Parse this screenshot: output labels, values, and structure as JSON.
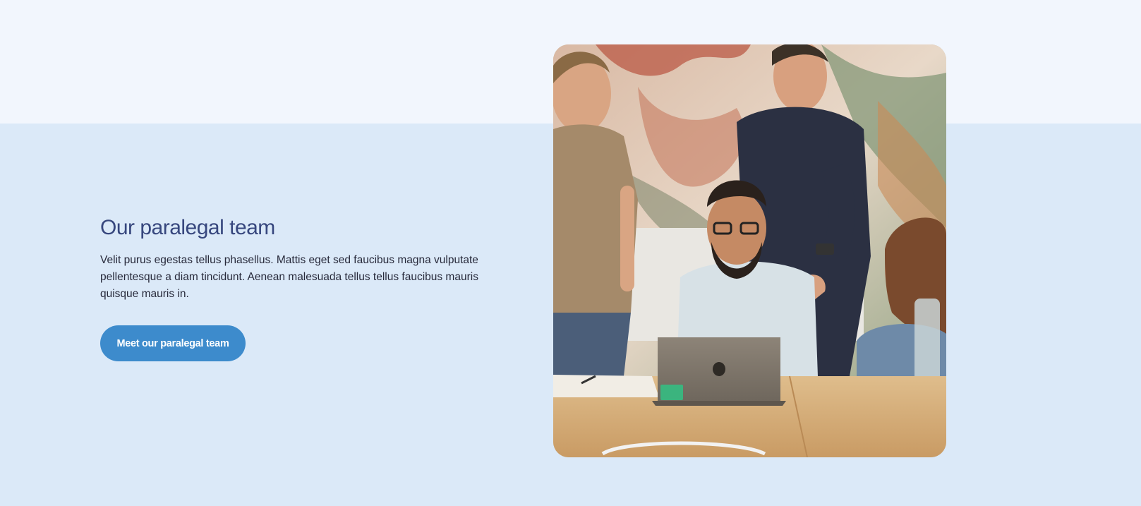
{
  "section": {
    "title": "Our paralegal team",
    "body": "Velit purus egestas tellus phasellus. Mattis eget sed faucibus magna vulputate pellentesque a diam tincidunt. Aenean malesuada tellus tellus faucibus mauris quisque mauris in.",
    "cta_label": "Meet our paralegal team"
  },
  "colors": {
    "page_background": "#dbe9f8",
    "top_band": "#f2f6fd",
    "title": "#37477e",
    "body_text": "#27293a",
    "button": "#3d8bcc",
    "button_text": "#ffffff"
  },
  "image": {
    "subject": "team-photo-people-around-laptop"
  }
}
